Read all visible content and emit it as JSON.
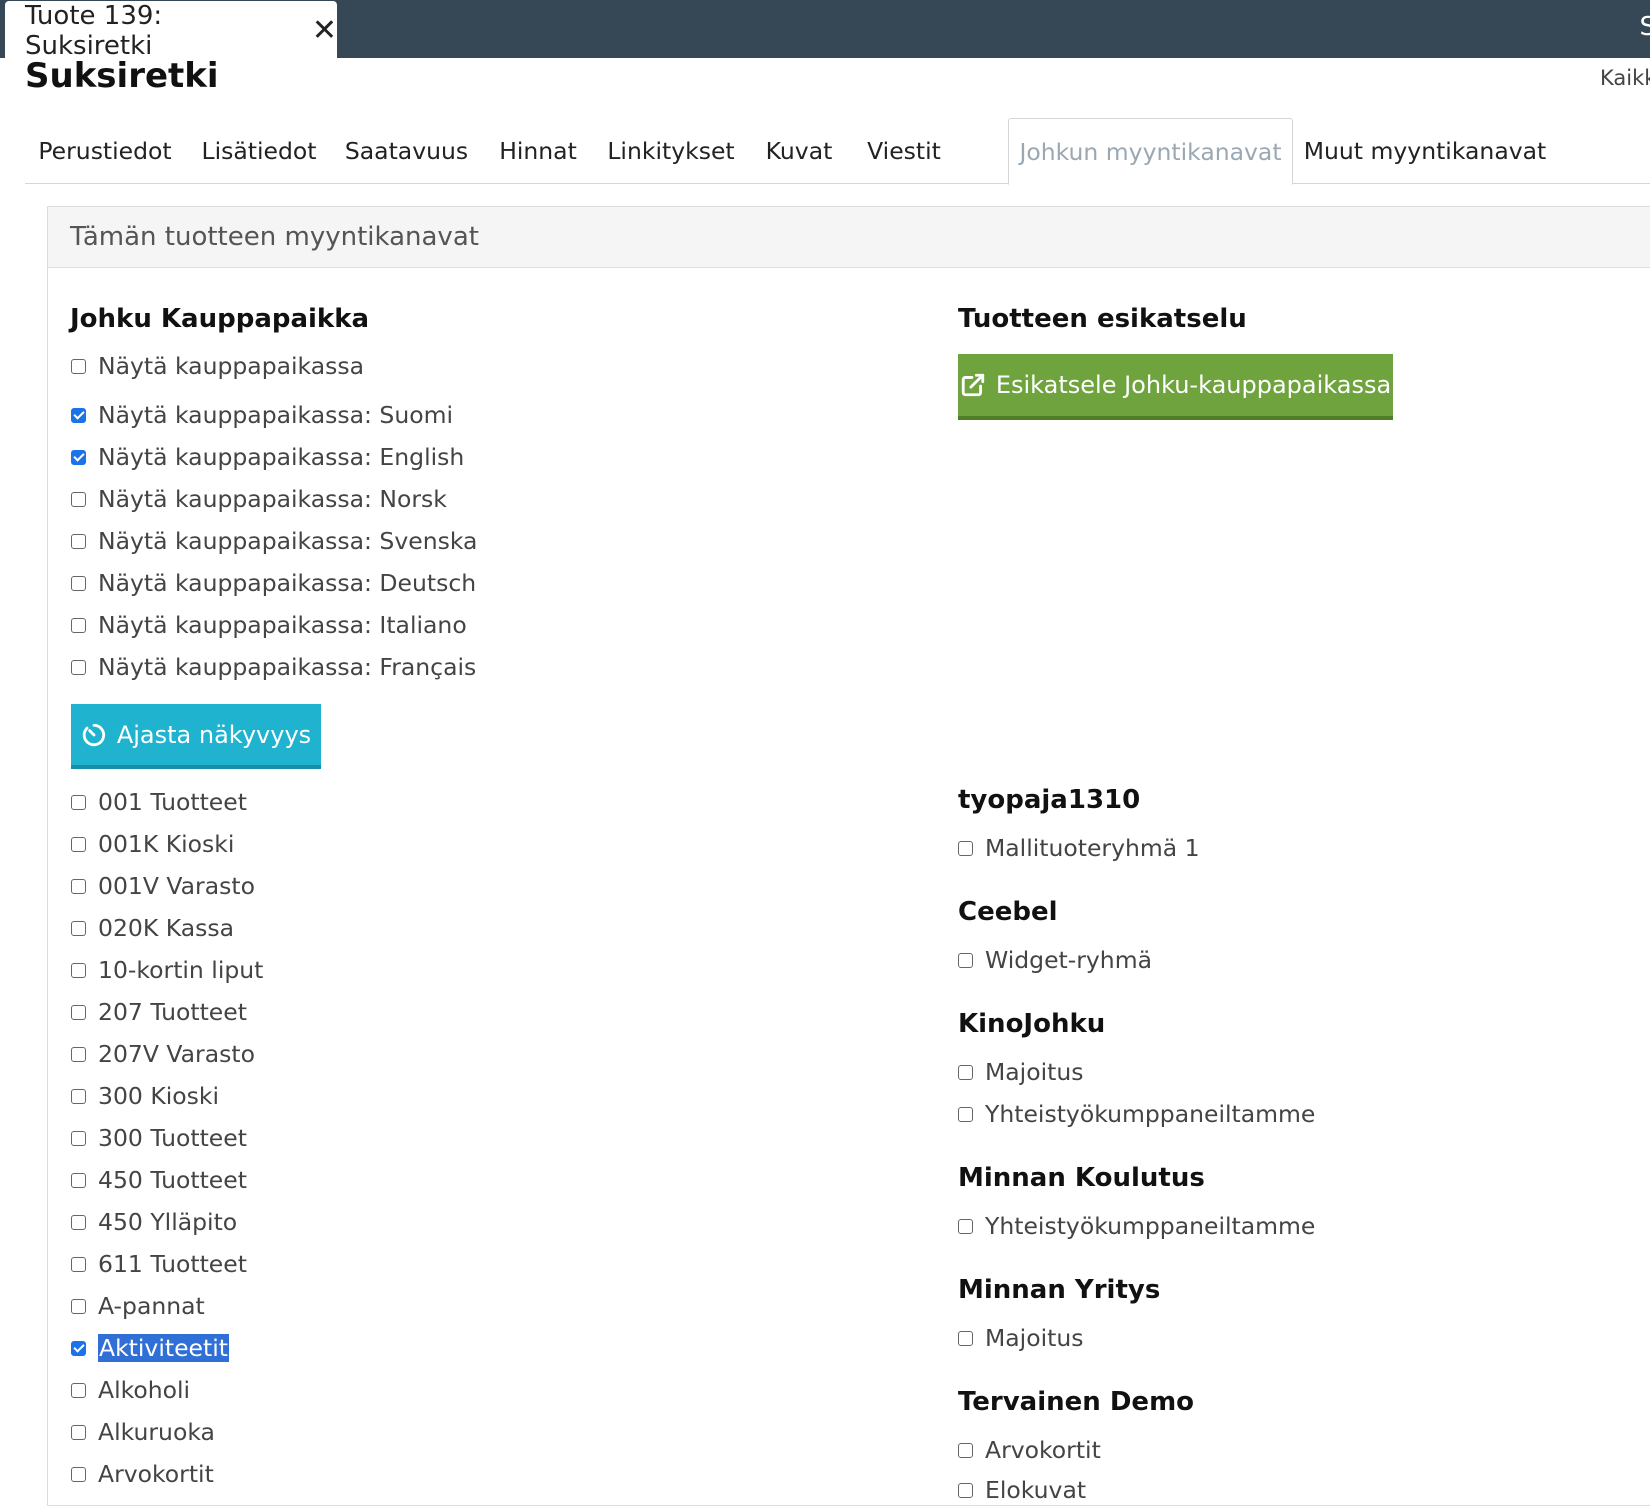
{
  "window_tab": {
    "title": "Tuote 139: Suksiretki",
    "close_icon": "close-icon"
  },
  "topbar": {
    "right_text": "S"
  },
  "page": {
    "title": "Suksiretki",
    "top_link": "Kaikk"
  },
  "tabs": [
    {
      "label": "Perustiedot"
    },
    {
      "label": "Lisätiedot"
    },
    {
      "label": "Saatavuus"
    },
    {
      "label": "Hinnat"
    },
    {
      "label": "Linkitykset"
    },
    {
      "label": "Kuvat"
    },
    {
      "label": "Viestit"
    },
    {
      "label": "Johkun myyntikanavat",
      "active": true
    },
    {
      "label": "Muut myyntikanavat"
    }
  ],
  "panel": {
    "title": "Tämän tuotteen myyntikanavat"
  },
  "marketplace": {
    "heading": "Johku Kauppapaikka",
    "options": [
      {
        "label": "Näytä kauppapaikassa",
        "checked": false
      },
      {
        "label": "Näytä kauppapaikassa: Suomi",
        "checked": true
      },
      {
        "label": "Näytä kauppapaikassa: English",
        "checked": true
      },
      {
        "label": "Näytä kauppapaikassa: Norsk",
        "checked": false
      },
      {
        "label": "Näytä kauppapaikassa: Svenska",
        "checked": false
      },
      {
        "label": "Näytä kauppapaikassa: Deutsch",
        "checked": false
      },
      {
        "label": "Näytä kauppapaikassa: Italiano",
        "checked": false
      },
      {
        "label": "Näytä kauppapaikassa: Français",
        "checked": false
      }
    ],
    "schedule_button": "Ajasta näkyvyys",
    "groups": [
      {
        "label": "001 Tuotteet",
        "checked": false
      },
      {
        "label": "001K Kioski",
        "checked": false
      },
      {
        "label": "001V Varasto",
        "checked": false
      },
      {
        "label": "020K Kassa",
        "checked": false
      },
      {
        "label": "10-kortin liput",
        "checked": false
      },
      {
        "label": "207 Tuotteet",
        "checked": false
      },
      {
        "label": "207V Varasto",
        "checked": false
      },
      {
        "label": "300 Kioski",
        "checked": false
      },
      {
        "label": "300 Tuotteet",
        "checked": false
      },
      {
        "label": "450 Tuotteet",
        "checked": false
      },
      {
        "label": "450 Ylläpito",
        "checked": false
      },
      {
        "label": "611 Tuotteet",
        "checked": false
      },
      {
        "label": "A-pannat",
        "checked": false
      },
      {
        "label": "Aktiviteetit",
        "checked": true,
        "highlighted": true
      },
      {
        "label": "Alkoholi",
        "checked": false
      },
      {
        "label": "Alkuruoka",
        "checked": false
      },
      {
        "label": "Arvokortit",
        "checked": false
      }
    ]
  },
  "preview": {
    "heading": "Tuotteen esikatselu",
    "button": "Esikatsele Johku-kauppapaikassa"
  },
  "channels": [
    {
      "heading": "tyopaja1310",
      "options": [
        {
          "label": "Mallituoteryhmä 1",
          "checked": false
        }
      ]
    },
    {
      "heading": "Ceebel",
      "options": [
        {
          "label": "Widget-ryhmä",
          "checked": false
        }
      ]
    },
    {
      "heading": "KinoJohku",
      "options": [
        {
          "label": "Majoitus",
          "checked": false
        },
        {
          "label": "Yhteistyökumppaneiltamme",
          "checked": false
        }
      ]
    },
    {
      "heading": "Minnan Koulutus",
      "options": [
        {
          "label": "Yhteistyökumppaneiltamme",
          "checked": false
        }
      ]
    },
    {
      "heading": "Minnan Yritys",
      "options": [
        {
          "label": "Majoitus",
          "checked": false
        }
      ]
    },
    {
      "heading": "Tervainen Demo",
      "options": [
        {
          "label": "Arvokortit",
          "checked": false
        },
        {
          "label": "Elokuvat",
          "checked": false
        }
      ]
    }
  ]
}
